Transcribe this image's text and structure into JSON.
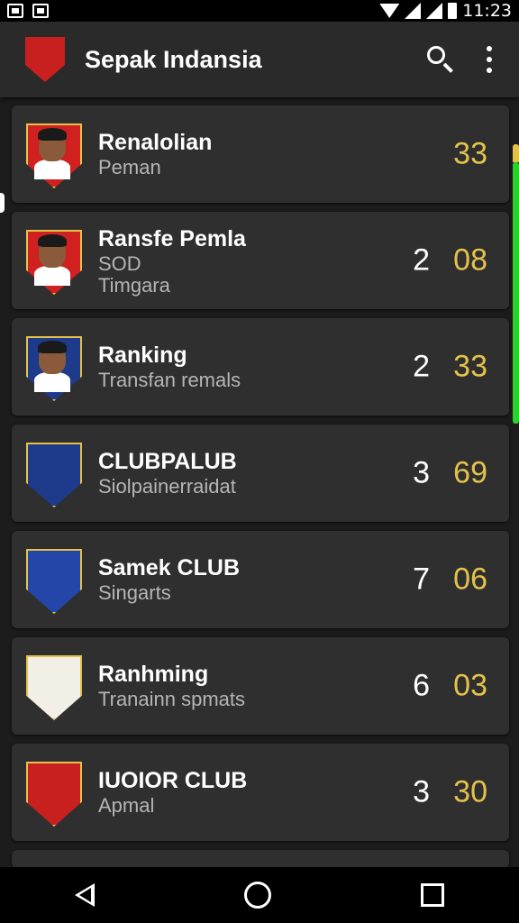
{
  "status_bar": {
    "time": "11:23"
  },
  "app_bar": {
    "title": "Sepak Indansia",
    "logo_color": "#c8201f"
  },
  "items": [
    {
      "title": "Renalolian",
      "subtitle": "Peman",
      "subtitle2": "",
      "rank": "",
      "score": "33",
      "badge_color": "#d02020",
      "type": "player"
    },
    {
      "title": "Ransfe Pemla",
      "subtitle": "SOD",
      "subtitle2": "Timgara",
      "rank": "2",
      "score": "08",
      "badge_color": "#d02020",
      "type": "player"
    },
    {
      "title": "Ranking",
      "subtitle": "Transfan remals",
      "subtitle2": "",
      "rank": "2",
      "score": "33",
      "badge_color": "#1e3a8a",
      "type": "player"
    },
    {
      "title": "CLUBPALUB",
      "subtitle": "Siolpainerraidat",
      "subtitle2": "",
      "rank": "3",
      "score": "69",
      "badge_color": "#1e3a8a",
      "type": "club"
    },
    {
      "title": "Samek CLUB",
      "subtitle": "Singarts",
      "subtitle2": "",
      "rank": "7",
      "score": "06",
      "badge_color": "#2446a8",
      "type": "club"
    },
    {
      "title": "Ranhming",
      "subtitle": "Tranainn spmats",
      "subtitle2": "",
      "rank": "6",
      "score": "03",
      "badge_color": "#f2efe6",
      "type": "club"
    },
    {
      "title": "IUOIOR CLUB",
      "subtitle": "Apmal",
      "subtitle2": "",
      "rank": "3",
      "score": "30",
      "badge_color": "#c8201f",
      "type": "club"
    }
  ],
  "colors": {
    "score": "#e4c24a",
    "accent": "#2ad12a"
  }
}
